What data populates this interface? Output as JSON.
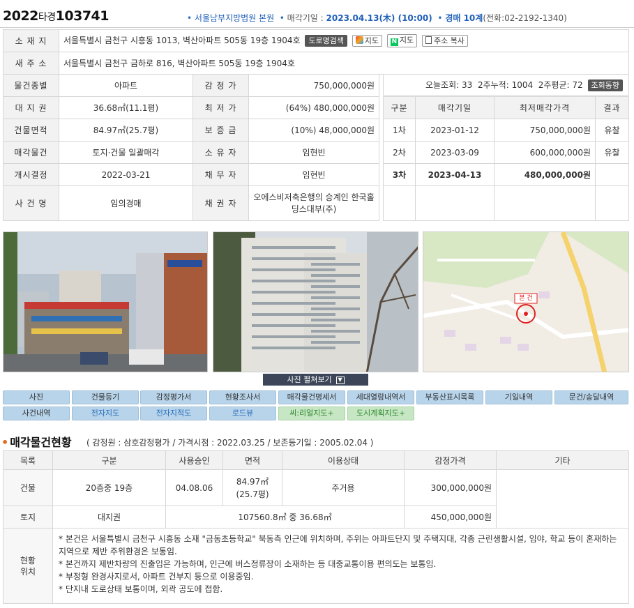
{
  "header": {
    "case_year": "2022",
    "case_type": "타경",
    "case_number": "103741",
    "court": "서울남부지방법원 본원",
    "sale_date_label": "매각기일 :",
    "sale_date": "2023.04.13(木) (10:00)",
    "auction_dept": "경매 10계",
    "phone": "(전화:02-2192-1340)"
  },
  "info": {
    "location_label": "소 재 지",
    "location": "서울특별시 금천구 시흥동 1013, 벽산아파트 505동 19층 1904호",
    "btn_road": "도로명검색",
    "btn_daum_map": "지도",
    "btn_naver_map": "지도",
    "btn_copy": "주소 복사",
    "new_addr_label": "새 주 소",
    "new_addr": "서울특별시 금천구 금하로 816, 벽산아파트 505동 19층 1904호",
    "rows": [
      {
        "l1": "물건종별",
        "v1": "아파트",
        "l2": "감 정 가",
        "v2": "750,000,000원"
      },
      {
        "l1": "대 지 권",
        "v1": "36.68㎡(11.1평)",
        "l2": "최 저 가",
        "v2": "(64%) 480,000,000원"
      },
      {
        "l1": "건물면적",
        "v1": "84.97㎡(25.7평)",
        "l2": "보 증 금",
        "v2": "(10%) 48,000,000원"
      },
      {
        "l1": "매각물건",
        "v1": "토지·건물 일괄매각",
        "l2": "소 유 자",
        "v2": "임현빈"
      },
      {
        "l1": "개시결정",
        "v1": "2022-03-21",
        "l2": "채 무 자",
        "v2": "임현빈"
      },
      {
        "l1": "사 건 명",
        "v1": "임의경매",
        "l2": "채 권 자",
        "v2": "오에스비저축은행의 승계인 한국홀딩스대부(주)"
      }
    ]
  },
  "views": {
    "today_label": "오늘조회:",
    "today": "33",
    "two_week_label": "2주누적:",
    "two_week": "1004",
    "two_week_avg_label": "2주평균:",
    "two_week_avg": "72",
    "trend_btn": "조회동향"
  },
  "history": {
    "headers": [
      "구분",
      "매각기일",
      "최저매각가격",
      "결과"
    ],
    "rows": [
      {
        "round": "1차",
        "date": "2023-01-12",
        "price": "750,000,000원",
        "result": "유찰"
      },
      {
        "round": "2차",
        "date": "2023-03-09",
        "price": "600,000,000원",
        "result": "유찰"
      },
      {
        "round": "3차",
        "date": "2023-04-13",
        "price": "480,000,000원",
        "result": ""
      }
    ]
  },
  "photos": {
    "toggle_label": "사진 펼쳐보기",
    "map_marker_label": "본 건"
  },
  "tabs": {
    "row1": [
      "사진",
      "건물등기",
      "감정평가서",
      "현황조사서",
      "매각물건명세서",
      "세대열람내역서",
      "부동산표시목록",
      "기일내역",
      "문건/송달내역"
    ],
    "row2": [
      "사건내역",
      "전자지도",
      "전자지적도",
      "로드뷰",
      "씨:리얼지도+",
      "도시계획지도+"
    ]
  },
  "status": {
    "title": "매각물건현황",
    "subtitle": "( 감정원 : 삼호감정평가 / 가격시점 : 2022.03.25 / 보존등기일 : 2005.02.04 )",
    "headers": [
      "목록",
      "구분",
      "사용승인",
      "면적",
      "이용상태",
      "감정가격",
      "기타"
    ],
    "building": {
      "type": "건물",
      "category": "20층중 19층",
      "approval": "04.08.06",
      "area1": "84.97㎡",
      "area2": "(25.7평)",
      "use": "주거용",
      "price": "300,000,000원"
    },
    "land": {
      "type": "토지",
      "category": "대지권",
      "area": "107560.8㎡ 중 36.68㎡",
      "price": "450,000,000원"
    },
    "location_label_1": "현황",
    "location_label_2": "위치",
    "notes": [
      "* 본건은 서울특별시 금천구 시흥동 소재 \"금동초등학교\" 북동측 인근에 위치하며, 주위는 아파트단지 및 주택지대, 각종 근린생활시설, 임야, 학교 등이 혼재하는 지역으로 제반 주위환경은 보통임.",
      "* 본건까지 제반차량의 진출입은 가능하며, 인근에 버스정류장이 소재하는 등 대중교통이용 편의도는 보통임.",
      "* 부정형 완경사지로서, 아파트 건부지 등으로 이용중임.",
      "* 단지내 도로상태 보통이며, 외곽 공도에 접함."
    ]
  }
}
